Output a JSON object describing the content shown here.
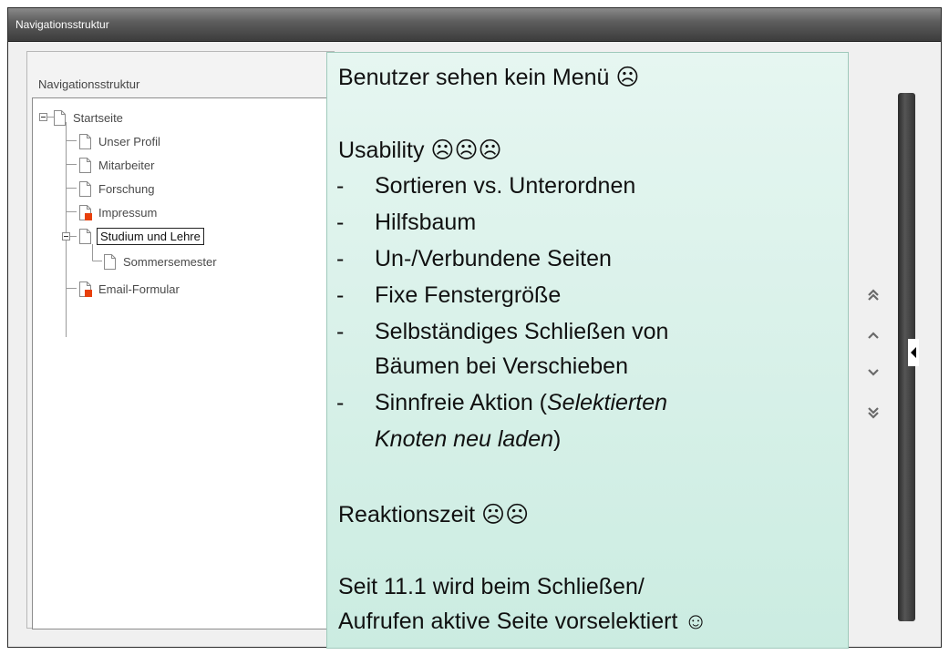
{
  "window": {
    "title": "Navigationsstruktur"
  },
  "tree": {
    "label": "Navigationsstruktur",
    "nodes": [
      {
        "label": "Startseite",
        "type": "doc"
      },
      {
        "label": "Unser Profil",
        "type": "doc"
      },
      {
        "label": "Mitarbeiter",
        "type": "doc"
      },
      {
        "label": "Forschung",
        "type": "doc"
      },
      {
        "label": "Impressum",
        "type": "doc-red"
      },
      {
        "label": "Studium und Lehre",
        "type": "doc"
      },
      {
        "label": "Sommersemester",
        "type": "doc"
      },
      {
        "label": "Email-Formular",
        "type": "doc-red"
      }
    ]
  },
  "overlay": {
    "line1": "Benutzer sehen kein Menü ☹",
    "usability_title": "Usability ☹☹☹",
    "dash": "-",
    "items": [
      "Sortieren vs. Unterordnen",
      "Hilfsbaum",
      "Un-/Verbundene Seiten",
      "Fixe Fenstergröße",
      "Selbständiges Schließen von",
      "Bäumen bei Verschieben",
      "Sinnfreie Aktion (",
      "Selektierten",
      "Knoten neu laden",
      ")"
    ],
    "reaktion": "Reaktionszeit ☹☹",
    "seit_line1": "Seit 11.1 wird beim Schließen/",
    "seit_line2": "Aufrufen aktive Seite vorselektiert ☺"
  },
  "nav_buttons": {
    "top": "⏫",
    "up": "⌃",
    "down": "⌄",
    "bottom": "⏬"
  },
  "icons": {
    "doc": "document-icon",
    "doc_red": "document-red-icon",
    "expander": "collapse-minus-icon"
  }
}
